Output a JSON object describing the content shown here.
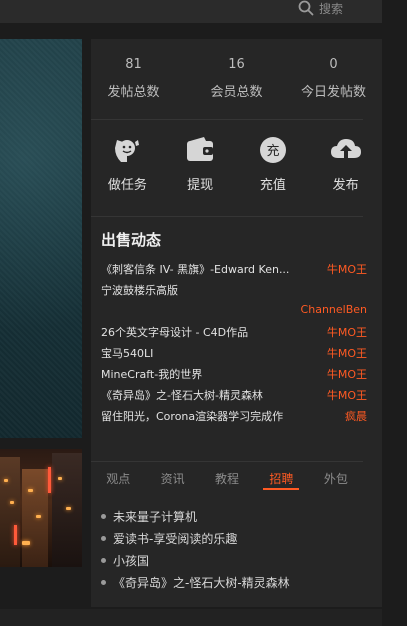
{
  "search": {
    "label": "搜索"
  },
  "stats": [
    {
      "value": "81",
      "label": "发帖总数"
    },
    {
      "value": "16",
      "label": "会员总数"
    },
    {
      "value": "0",
      "label": "今日发帖数"
    }
  ],
  "actions": [
    {
      "label": "做任务",
      "icon": "task-icon"
    },
    {
      "label": "提现",
      "icon": "wallet-icon"
    },
    {
      "label": "充值",
      "icon": "recharge-icon",
      "glyph": "充"
    },
    {
      "label": "发布",
      "icon": "upload-icon"
    }
  ],
  "sales": {
    "title": "出售动态",
    "items": [
      {
        "title": "《刺客信条 IV- 黑旗》-Edward Ken...",
        "author": "牛MO王"
      },
      {
        "title": "宁波鼓楼乐高版",
        "author": "ChannelBen"
      },
      {
        "title": "26个英文字母设计 - C4D作品",
        "author": "牛MO王"
      },
      {
        "title": "宝马540LI",
        "author": "牛MO王"
      },
      {
        "title": "MineCraft-我的世界",
        "author": "牛MO王"
      },
      {
        "title": "《奇异岛》之-怪石大树-精灵森林",
        "author": "牛MO王"
      },
      {
        "title": "留住阳光，Corona渲染器学习完成作",
        "author": "疯晨"
      }
    ]
  },
  "tabs": [
    {
      "label": "观点",
      "active": false
    },
    {
      "label": "资讯",
      "active": false
    },
    {
      "label": "教程",
      "active": false
    },
    {
      "label": "招聘",
      "active": true
    },
    {
      "label": "外包",
      "active": false
    }
  ],
  "list": [
    "未来量子计算机",
    "爱读书-享受阅读的乐趣",
    "小孩国",
    "《奇异岛》之-怪石大树-精灵森林"
  ],
  "colors": {
    "accent": "#ff5a23",
    "panel": "#262626",
    "background": "#1c1c1c"
  }
}
